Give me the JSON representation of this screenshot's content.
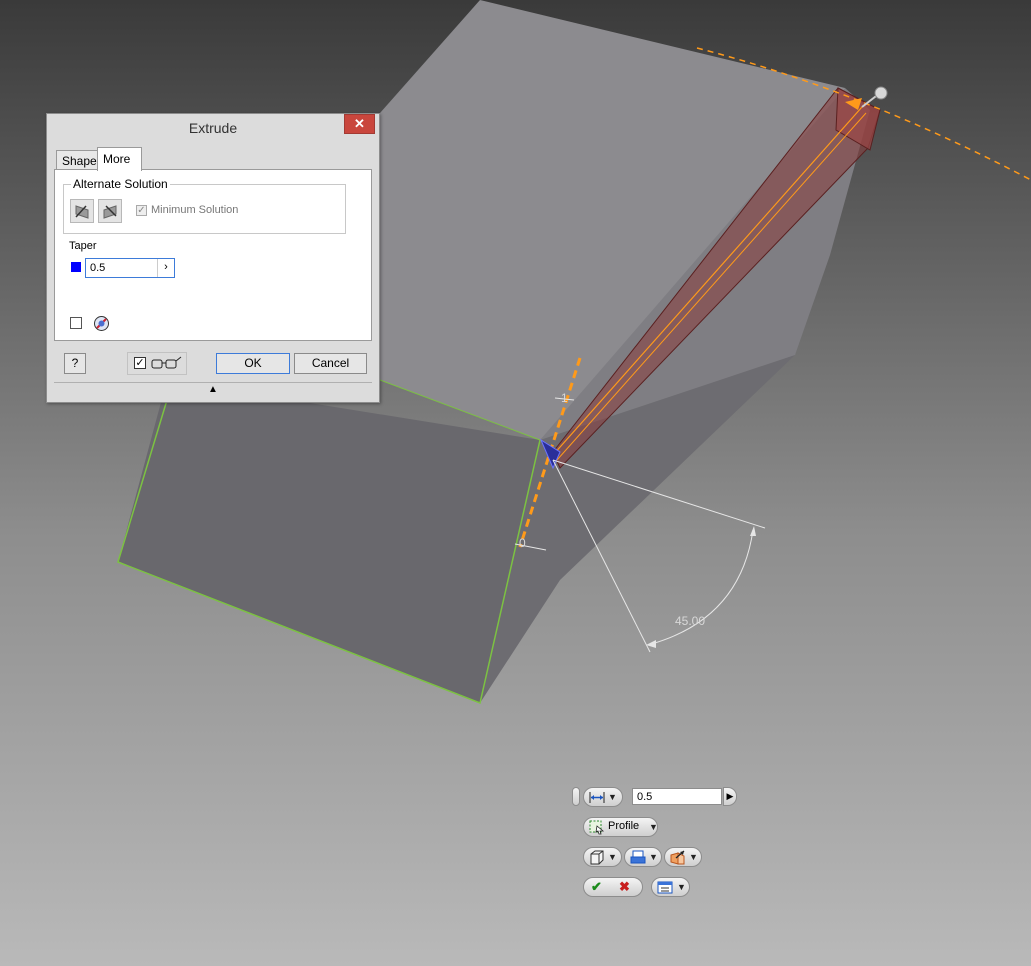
{
  "viewport": {
    "angle_dimension": "45.00",
    "small_dim_1": "1",
    "small_dim_2": "0"
  },
  "dialog": {
    "title": "Extrude",
    "close_glyph": "✕",
    "tabs": [
      {
        "label": "Shape",
        "active": false
      },
      {
        "label": "More",
        "active": true
      }
    ],
    "alternate_solution": {
      "legend": "Alternate Solution",
      "minimum_solution_label": "Minimum Solution",
      "minimum_solution_checked": true,
      "minimum_solution_enabled": false
    },
    "taper": {
      "label": "Taper",
      "value": "0.5",
      "arrow": "›",
      "color": "#0000ff"
    },
    "footer": {
      "help_glyph": "?",
      "preview_checked": true,
      "preview_check_glyph": "✓",
      "ok_label": "OK",
      "cancel_label": "Cancel",
      "expand_glyph": "▲"
    }
  },
  "mini_toolbar": {
    "distance_value": "0.5",
    "value_arrow": "▶",
    "profile_label": "Profile",
    "dropdown_glyph": "▼"
  },
  "colors": {
    "background_top": "#3a3a3a",
    "background_bottom": "#b9b9b9",
    "edge_highlight": "#7cc242",
    "accent_orange": "#ff9a1a",
    "preview_red": "#8a3c3c"
  }
}
